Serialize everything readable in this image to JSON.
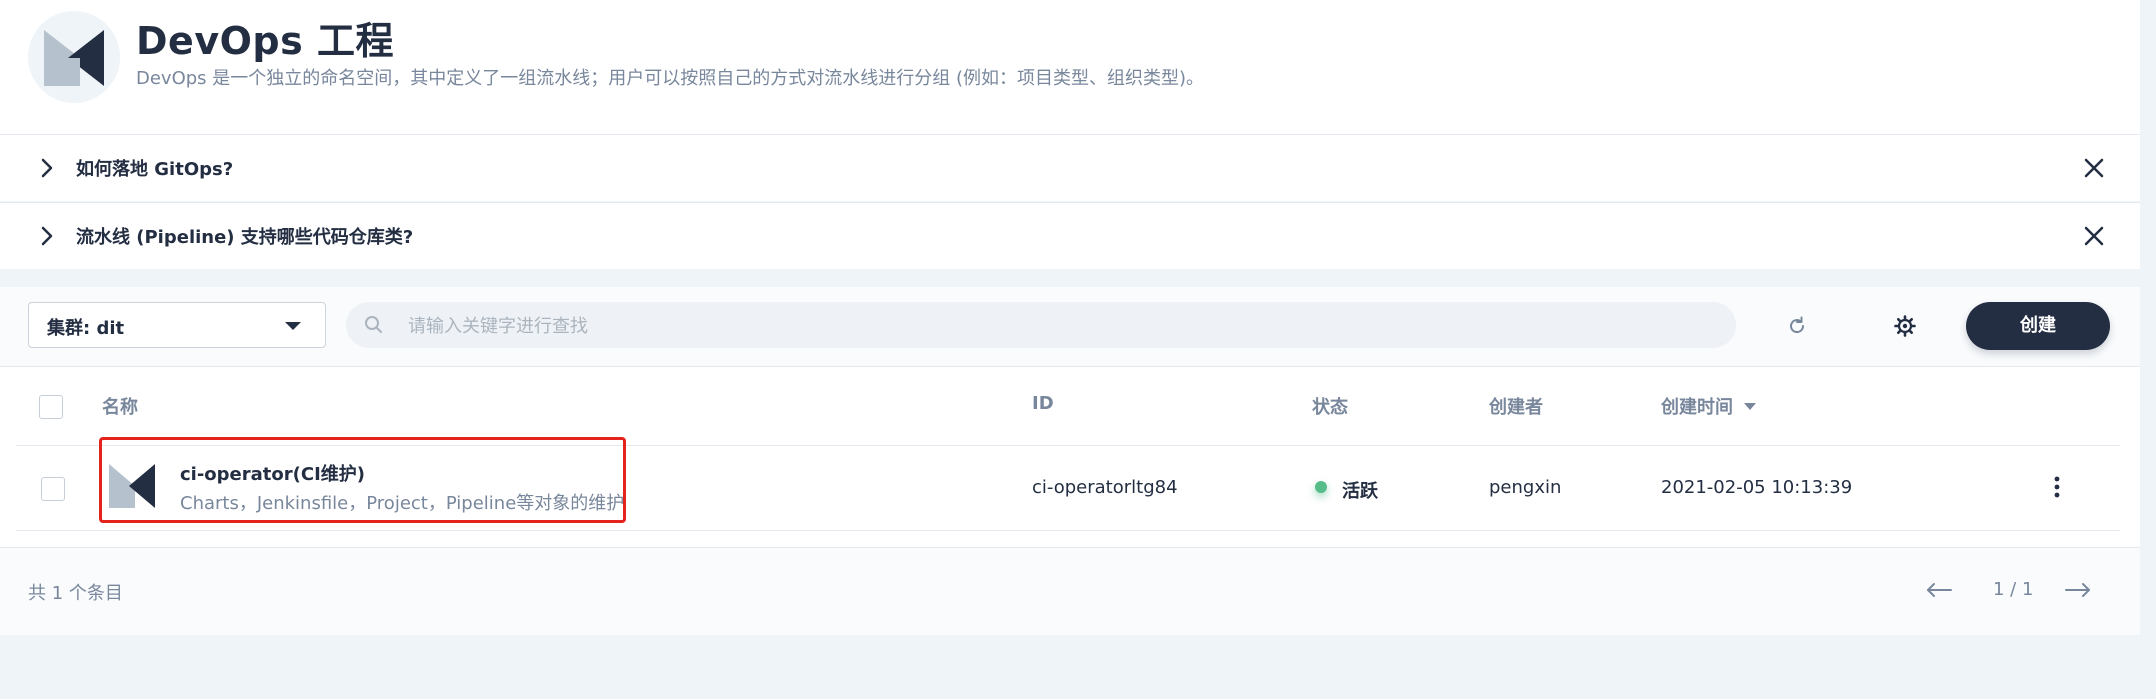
{
  "header": {
    "title": "DevOps 工程",
    "description": "DevOps 是一个独立的命名空间，其中定义了一组流水线；用户可以按照自己的方式对流水线进行分组 (例如：项目类型、组织类型)。"
  },
  "faq": [
    {
      "label": "如何落地 GitOps?"
    },
    {
      "label": "流水线 (Pipeline) 支持哪些代码仓库类?"
    }
  ],
  "toolbar": {
    "cluster_label": "集群: dit",
    "search_placeholder": "请输入关键字进行查找",
    "create_label": "创建"
  },
  "table": {
    "columns": [
      "名称",
      "ID",
      "状态",
      "创建者",
      "创建时间"
    ],
    "sorted_column": "创建时间",
    "rows": [
      {
        "name": "ci-operator(CI维护)",
        "description": "Charts，Jenkinsfile，Project，Pipeline等对象的维护",
        "id": "ci-operatorltg84",
        "status": "活跃",
        "creator": "pengxin",
        "created_at": "2021-02-05 10:13:39",
        "highlighted": true
      }
    ]
  },
  "footer": {
    "total": "共 1 个条目",
    "pages": "1 / 1"
  },
  "colors": {
    "primary_dark": "#242e42",
    "status_active": "#55bc8a",
    "highlight_border": "#e3231c",
    "muted_text": "#79879c"
  },
  "icons": [
    "devops-logo-icon",
    "chevron-right-icon",
    "close-icon",
    "search-icon",
    "refresh-icon",
    "gear-icon",
    "more-vertical-icon",
    "arrow-left-icon",
    "arrow-right-icon",
    "sort-desc-icon"
  ]
}
